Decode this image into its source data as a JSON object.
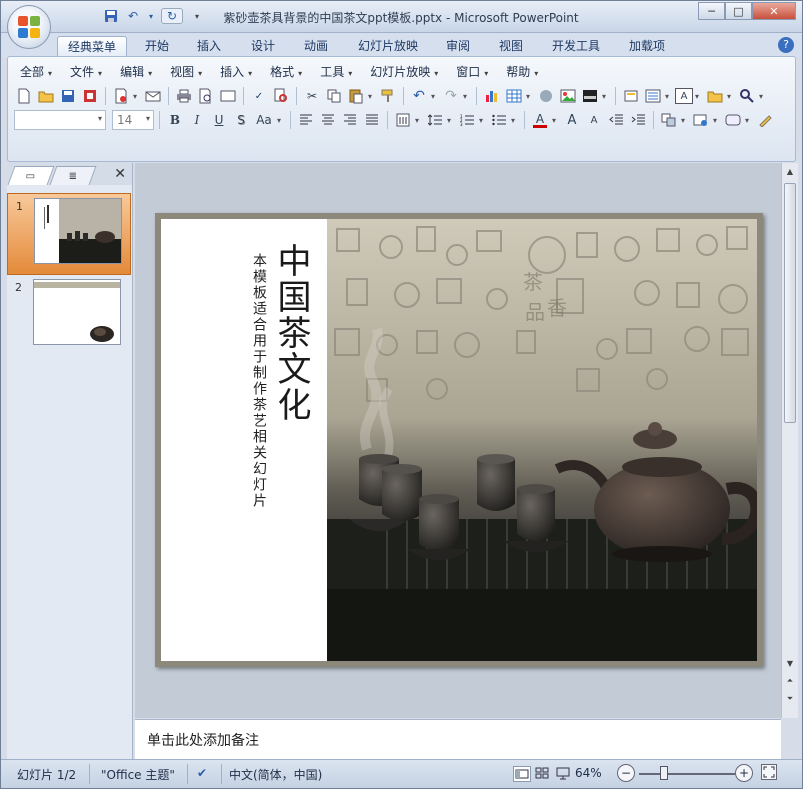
{
  "window": {
    "title": "紫砂壶茶具背景的中国茶文ppt模板.pptx - Microsoft PowerPoint",
    "controls": {
      "minimize": "─",
      "maximize": "□",
      "close": "✕"
    }
  },
  "ribbon": {
    "tabs": [
      {
        "label": "经典菜单",
        "active": true
      },
      {
        "label": "开始"
      },
      {
        "label": "插入"
      },
      {
        "label": "设计"
      },
      {
        "label": "动画"
      },
      {
        "label": "幻灯片放映"
      },
      {
        "label": "审阅"
      },
      {
        "label": "视图"
      },
      {
        "label": "开发工具"
      },
      {
        "label": "加载项"
      }
    ],
    "menus": [
      "全部",
      "文件",
      "编辑",
      "视图",
      "插入",
      "格式",
      "工具",
      "幻灯片放映",
      "窗口",
      "帮助"
    ],
    "font_size_value": "14",
    "font_name_value": "",
    "format_buttons": {
      "bold": "B",
      "italic": "I",
      "underline": "U",
      "shadow": "S",
      "case": "Aa",
      "font_color": "A",
      "grow": "A",
      "shrink": "A"
    }
  },
  "left_panel": {
    "tab_slides": "▭",
    "tab_outline": "≣",
    "close": "✕",
    "slides": [
      {
        "number": "1",
        "selected": true
      },
      {
        "number": "2",
        "selected": false
      }
    ]
  },
  "slide": {
    "heading": "中国茶文化",
    "subheading": "本模板适合用于制作茶艺相关幻灯片"
  },
  "notes": {
    "placeholder": "单击此处添加备注"
  },
  "status": {
    "slide_info": "幻灯片 1/2",
    "theme": "\"Office 主题\"",
    "language": "中文(简体，中国)",
    "zoom": "64%"
  }
}
